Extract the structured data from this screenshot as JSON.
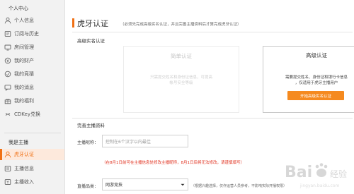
{
  "sidebar": {
    "personal_heading": "个人中心",
    "personal_items": [
      {
        "label": "个人信息",
        "icon": "user-icon"
      },
      {
        "label": "订阅与历史",
        "icon": "subscription-icon"
      },
      {
        "label": "房间管理",
        "icon": "room-icon"
      },
      {
        "label": "我的财产",
        "icon": "wallet-icon"
      },
      {
        "label": "我的竞猜",
        "icon": "bet-icon"
      },
      {
        "label": "我的消息",
        "icon": "message-icon"
      },
      {
        "label": "我的福利",
        "icon": "gift-icon"
      },
      {
        "label": "CDKey兑换",
        "icon": "key-icon"
      }
    ],
    "anchor_heading": "我是主播",
    "anchor_items": [
      {
        "label": "虎牙认证",
        "icon": "verify-icon",
        "active": true
      },
      {
        "label": "主播信息",
        "icon": "anchor-info-icon"
      },
      {
        "label": "主播收入",
        "icon": "income-icon"
      }
    ]
  },
  "main": {
    "title": "虎牙认证",
    "title_note": "（必须先完成高级实名认证，并且完善主播资料后才算完成虎牙认证）",
    "section_realname": "高级实名认证",
    "basic_card": {
      "title": "简单认证",
      "desc_line1": "只需提交姓名和身份证信息，可提高",
      "desc_line2": "帐号安全等级"
    },
    "advanced_card": {
      "title": "高级认证",
      "desc_line1": "需要提交姓名、身份证和银行卡信息",
      "desc_line2": "，仅适用于虎牙主播用户",
      "button": "开始高级实名认证"
    },
    "section_profile": "完善主播资料",
    "nickname": {
      "label": "主播昵称：",
      "placeholder": "控制在6个汉字以内最佳"
    },
    "warning": "（在8月1日前可在主播信息处修改主播昵称，8月1日后将无法修改，请谨慎填写）",
    "category": {
      "label": "直播品类：",
      "value": "网游竞技",
      "hint": "（根据兴趣选择，仅作运营人员参考，不影响实际开播权限）"
    }
  },
  "colors": {
    "accent": "#f07014",
    "button": "#f58a1f",
    "warning": "#e0301e"
  },
  "watermark": {
    "brand": "Baidu经验",
    "sub": "jingyan.baidu.com"
  }
}
